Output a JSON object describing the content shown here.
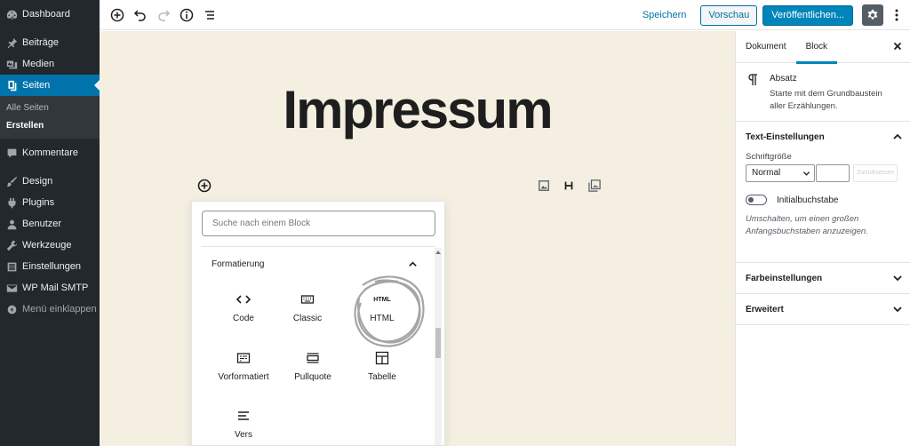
{
  "sidebar": {
    "items": [
      {
        "label": "Dashboard",
        "icon": "dashboard-icon"
      },
      {
        "label": "Beiträge",
        "icon": "pin-icon"
      },
      {
        "label": "Medien",
        "icon": "media-icon"
      },
      {
        "label": "Seiten",
        "icon": "pages-icon",
        "active": true
      },
      {
        "label": "Kommentare",
        "icon": "comments-icon"
      },
      {
        "label": "Design",
        "icon": "brush-icon"
      },
      {
        "label": "Plugins",
        "icon": "plugin-icon"
      },
      {
        "label": "Benutzer",
        "icon": "users-icon"
      },
      {
        "label": "Werkzeuge",
        "icon": "wrench-icon"
      },
      {
        "label": "Einstellungen",
        "icon": "settings-icon"
      },
      {
        "label": "WP Mail SMTP",
        "icon": "mail-icon"
      },
      {
        "label": "Menü einklappen",
        "icon": "collapse-icon"
      }
    ],
    "submenu": [
      {
        "label": "Alle Seiten"
      },
      {
        "label": "Erstellen",
        "current": true
      }
    ]
  },
  "toolbar": {
    "save_label": "Speichern",
    "preview_label": "Vorschau",
    "publish_label": "Veröffentlichen..."
  },
  "editor": {
    "title": "Impressum"
  },
  "inserter": {
    "search_placeholder": "Suche nach einem Block",
    "panel_title": "Formatierung",
    "blocks": [
      {
        "label": "Code",
        "icon": "code-icon"
      },
      {
        "label": "Classic",
        "icon": "keyboard-icon"
      },
      {
        "label": "HTML",
        "icon": "html-icon",
        "icon_text": "HTML"
      },
      {
        "label": "Vorformatiert",
        "icon": "preformatted-icon"
      },
      {
        "label": "Pullquote",
        "icon": "pullquote-icon"
      },
      {
        "label": "Tabelle",
        "icon": "table-icon"
      },
      {
        "label": "Vers",
        "icon": "verse-icon"
      }
    ]
  },
  "settings": {
    "tabs": [
      "Dokument",
      "Block"
    ],
    "block_card": {
      "title": "Absatz",
      "description": "Starte mit dem Grundbaustein aller Erzählungen."
    },
    "text_settings": {
      "title": "Text-Einstellungen",
      "font_size_label": "Schriftgröße",
      "font_size_value": "Normal",
      "reset_label": "Zurücksetzen",
      "dropcap_label": "Initialbuchstabe",
      "dropcap_help": "Umschalten, um einen großen Anfangsbuchstaben anzuzeigen."
    },
    "color_settings": {
      "title": "Farbeinstellungen"
    },
    "advanced": {
      "title": "Erweitert"
    }
  }
}
